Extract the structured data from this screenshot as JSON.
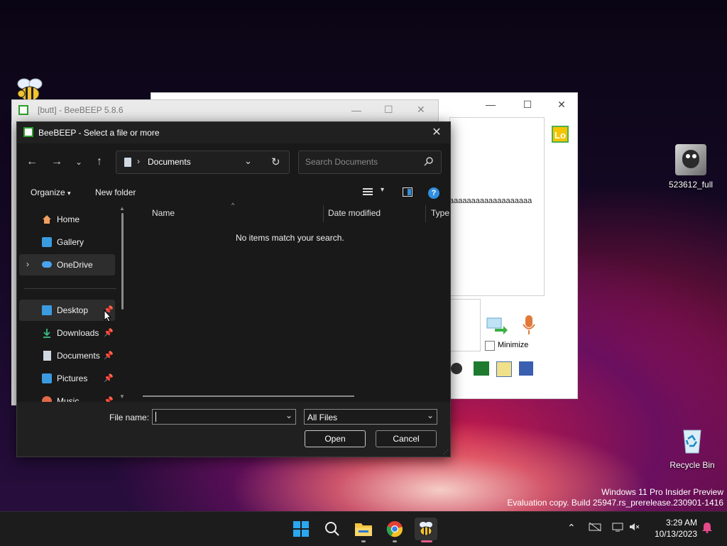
{
  "desktop": {
    "icons": [
      {
        "label": "523612_full"
      },
      {
        "label": "Recycle Bin"
      }
    ],
    "watermark": {
      "line1": "Windows 11 Pro Insider Preview",
      "line2": "Evaluation copy. Build 25947.rs_prerelease.230901-1416"
    }
  },
  "background_window": {
    "title": "[butt] - BeeBEEP 5.8.6",
    "log_text": "aaaaaaaaaaaaaaaaaaa",
    "lo_badge": "Lo",
    "minimize_label": "Minimize"
  },
  "dialog": {
    "title": "BeeBEEP - Select a file or more",
    "address": {
      "location": "Documents"
    },
    "search": {
      "placeholder": "Search Documents"
    },
    "toolbar": {
      "organize": "Organize",
      "new_folder": "New folder"
    },
    "nav_items": [
      {
        "label": "Home"
      },
      {
        "label": "Gallery"
      },
      {
        "label": "OneDrive"
      },
      {
        "label": "Desktop"
      },
      {
        "label": "Downloads"
      },
      {
        "label": "Documents"
      },
      {
        "label": "Pictures"
      },
      {
        "label": "Music"
      }
    ],
    "columns": {
      "name": "Name",
      "date_modified": "Date modified",
      "type": "Type"
    },
    "empty_message": "No items match your search.",
    "file_name_label": "File name:",
    "file_name_value": "",
    "filter_value": "All Files",
    "open_button": "Open",
    "cancel_button": "Cancel"
  },
  "taskbar": {
    "time": "3:29 AM",
    "date": "10/13/2023"
  },
  "colors": {
    "accent": "#0078d4",
    "dialog_bg": "#191919",
    "beebeep_green": "#2ca02c"
  }
}
